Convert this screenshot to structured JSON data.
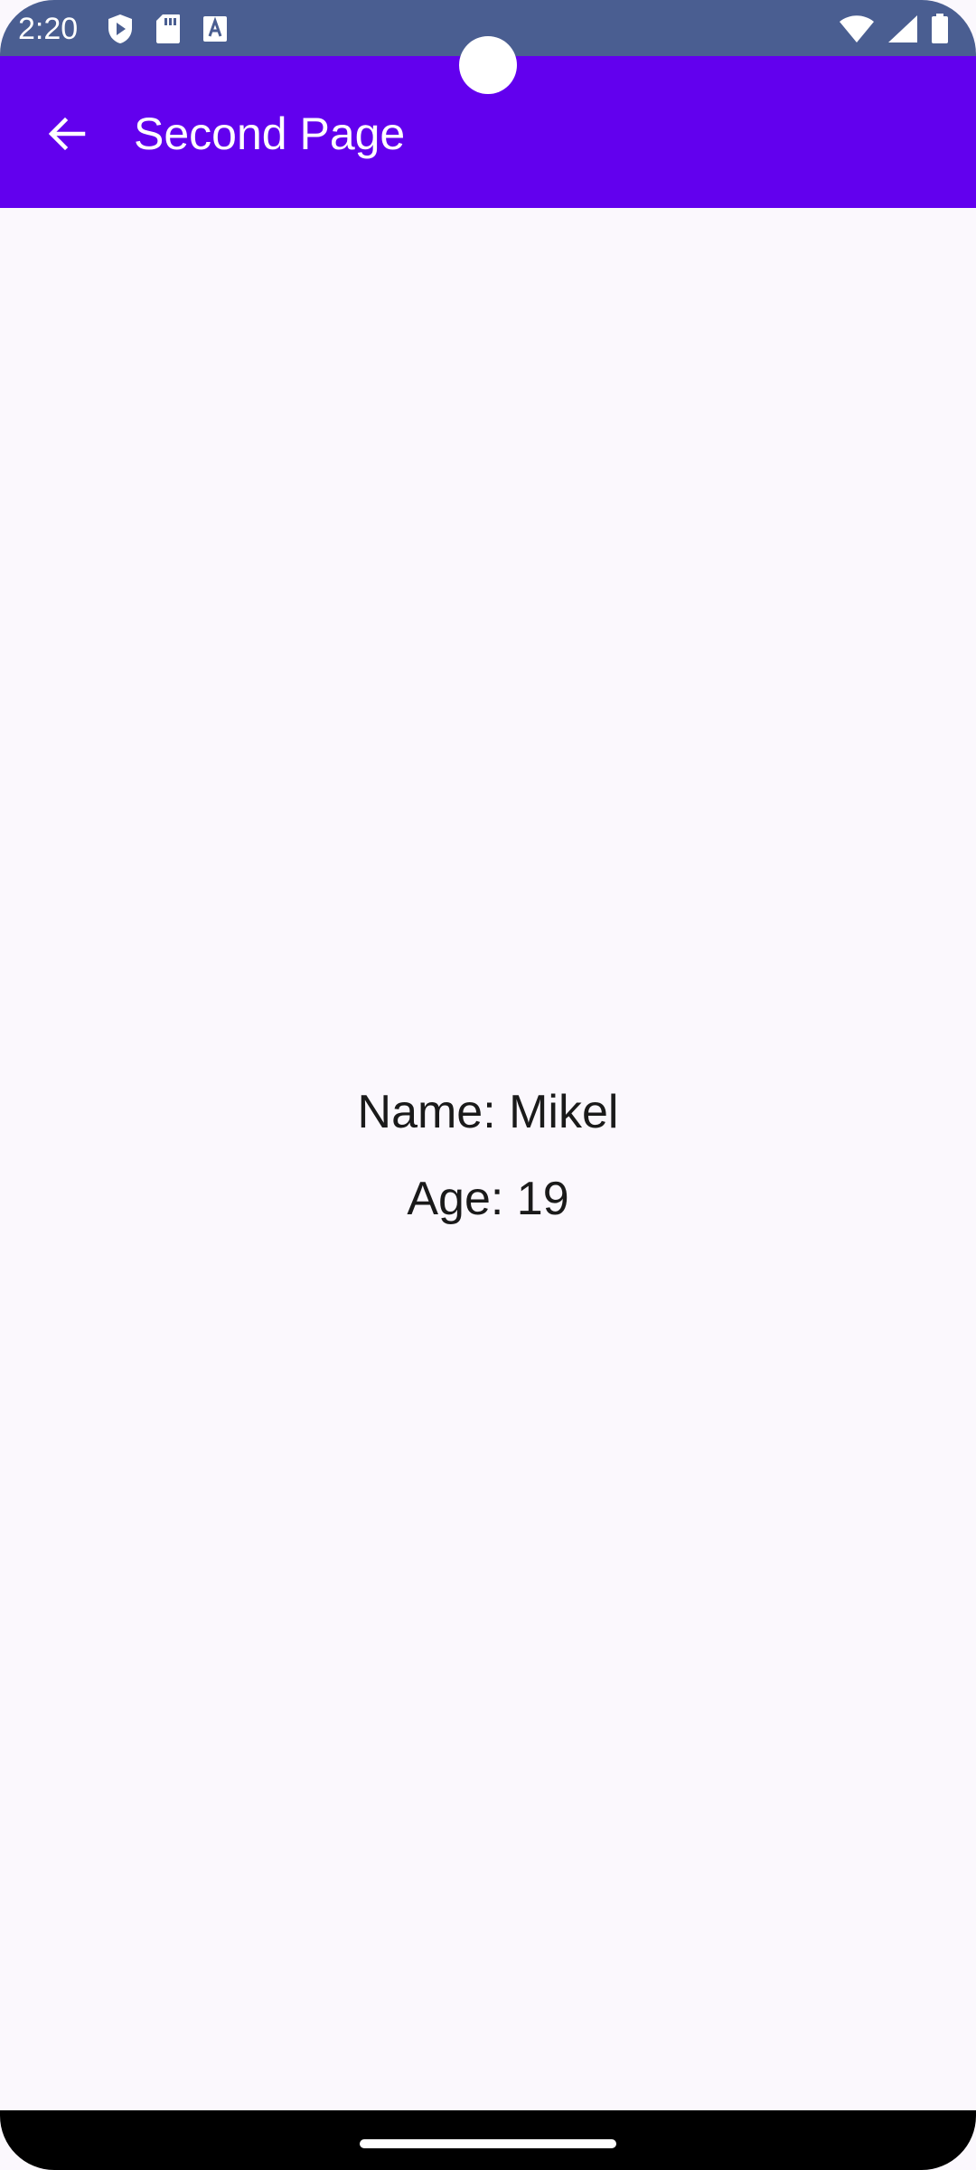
{
  "status_bar": {
    "time": "2:20",
    "left_icons": [
      "play-protect-icon",
      "sd-card-icon",
      "font-a-icon"
    ],
    "right_icons": [
      "wifi-icon",
      "cellular-signal-icon",
      "battery-icon"
    ],
    "background_color": "#4A5E91"
  },
  "app_bar": {
    "title": "Second Page",
    "back_icon": "arrow-back-icon",
    "background_color": "#6200EE"
  },
  "content": {
    "name_line": "Name: Mikel",
    "age_line": "Age: 19",
    "background_color": "#FBF8FD"
  },
  "nav_bar": {
    "handle_icon": "home-gesture-handle"
  }
}
